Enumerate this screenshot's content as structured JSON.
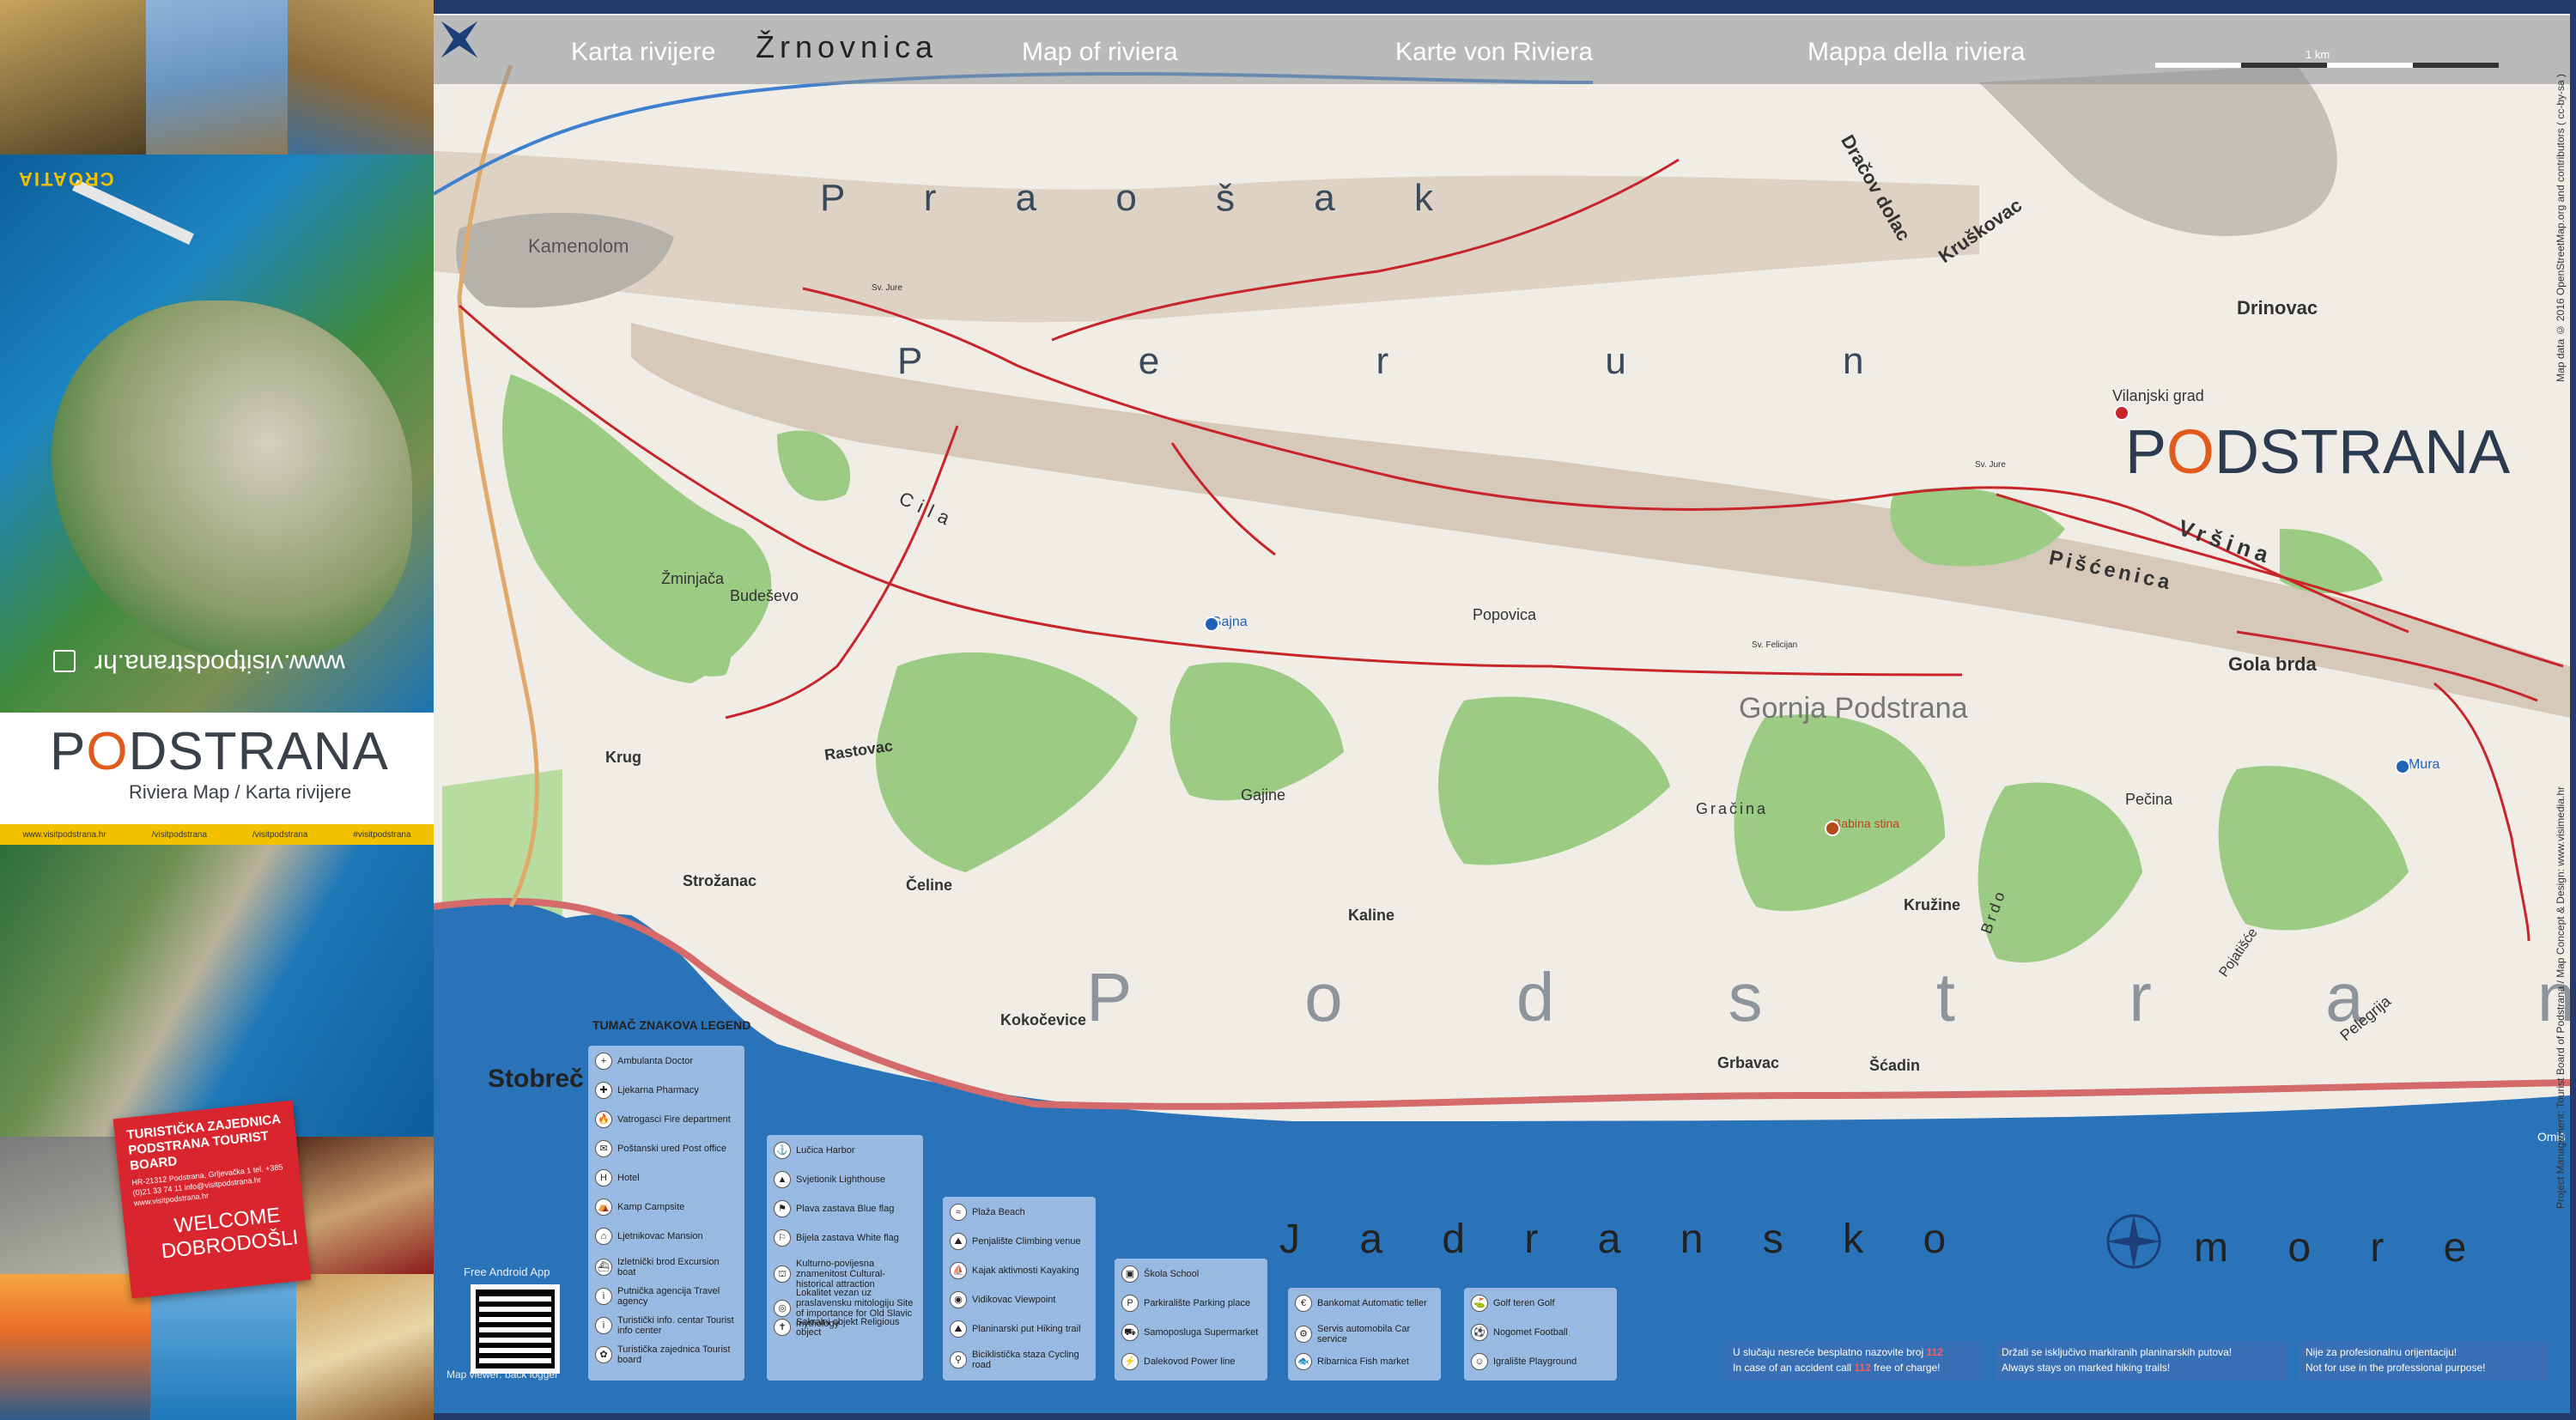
{
  "left_panel": {
    "croatia": "CROATIA",
    "website_rotated": "www.visitpodstrana.hr",
    "brand": {
      "pre": "P",
      "o": "O",
      "post": "DSTRANA"
    },
    "brand_sub": "Riviera Map / Karta rivijere",
    "social": [
      "www.visitpodstrana.hr",
      "/visitpodstrana",
      "/visitpodstrana",
      "#visitpodstrana"
    ],
    "tz": {
      "title": "TURISTIČKA ZAJEDNICA PODSTRANA TOURIST BOARD",
      "address": "HR-21312 Podstrana, Grljevačka 1 tel. +385 (0)21 33 74 11 info@visitpodstrana.hr www.visitpodstrana.hr",
      "welcome": "WELCOME DOBRODOŠLI"
    }
  },
  "map": {
    "titles": [
      "Karta rivijere",
      "Map of riviera",
      "Karte von Riviera",
      "Mappa della riviera"
    ],
    "scale": "1 km",
    "brand": {
      "pre": "P",
      "o": "O",
      "post": "DSTRANA"
    },
    "places": {
      "zrnovnica": "Žrnovnica",
      "kamenolom": "Kamenolom",
      "praosak": "P r a o š a k",
      "perun": "P e r u n",
      "dracov": "Dračov dolac",
      "kruskovac": "Kruškovac",
      "drinovac": "Drinovac",
      "vilanjski": "Vilanjski grad",
      "vrsina": "Vršina",
      "piscenica": "Pišćenica",
      "gola_brda": "Gola brda",
      "cila": "Cila",
      "zminjaca": "Žminjača",
      "budesevo": "Budeševo",
      "gajna": "Gajna",
      "popovica": "Popovica",
      "gornja": "Gornja Podstrana",
      "mura": "Mura",
      "krug": "Krug",
      "rastovac": "Rastovac",
      "gajine": "Gajine",
      "gracina": "Gračina",
      "babina": "Babina stina",
      "pecina": "Pečina",
      "strozanac": "Strožanac",
      "celine": "Čeline",
      "kaline": "Kaline",
      "kruzine": "Kružine",
      "brdo": "Brdo",
      "pojatisce": "Pojatišće",
      "podstrana_big": "P o d s t r a n a",
      "kokocevice": "Kokočevice",
      "grbavac": "Grbavac",
      "scadin": "Šćadin",
      "pelegrija": "Pelegrija",
      "stobrec": "Stobreč",
      "jadransko": "J a d r a n s k o",
      "more": "m o r e",
      "omis": "Omiš",
      "sv_jure": "Sv. Jure",
      "sv_jure2": "Sv. Jure",
      "sv_felicijan": "Sv. Felicijan"
    },
    "credit_top": "Map data © 2016 OpenStreetMap.org and contributors ( cc-by-sa )",
    "credit_bottom": "Project Management: Tourist Board of Podstrana / Map Concept & Design: www.visimedia.hr",
    "qr_top": "Free Android App",
    "qr_bottom": "Map viewer: back logger"
  },
  "legend": {
    "title": "TUMAČ ZNAKOVA LEGEND",
    "col1": [
      {
        "icon": "+",
        "label": "Ambulanta Doctor"
      },
      {
        "icon": "✚",
        "label": "Ljekarna Pharmacy"
      },
      {
        "icon": "🔥",
        "label": "Vatrogasci Fire department"
      },
      {
        "icon": "✉",
        "label": "Poštanski ured Post office"
      },
      {
        "icon": "H",
        "label": "Hotel"
      },
      {
        "icon": "⛺",
        "label": "Kamp Campsite"
      },
      {
        "icon": "⌂",
        "label": "Ljetnikovac Mansion"
      },
      {
        "icon": "⛴",
        "label": "Izletnički brod Excursion boat"
      },
      {
        "icon": "i",
        "label": "Putnička agencija Travel agency"
      },
      {
        "icon": "i",
        "label": "Turistički info. centar Tourist info center"
      },
      {
        "icon": "✿",
        "label": "Turistička zajednica Tourist board"
      }
    ],
    "col2": [
      {
        "icon": "⚓",
        "label": "Lučica Harbor"
      },
      {
        "icon": "▲",
        "label": "Svjetionik Lighthouse"
      },
      {
        "icon": "⚑",
        "label": "Plava zastava Blue flag"
      },
      {
        "icon": "⚐",
        "label": "Bijela zastava White flag"
      },
      {
        "icon": "⛫",
        "label": "Kulturno-povijesna znamenitost Cultural-historical attraction"
      },
      {
        "icon": "◎",
        "label": "Lokalitet vezan uz praslavensku mitologiju Site of importance for Old Slavic mythology"
      },
      {
        "icon": "✝",
        "label": "Sakralni objekt Religious object"
      }
    ],
    "col3": [
      {
        "icon": "≈",
        "label": "Plaža Beach"
      },
      {
        "icon": "⛰",
        "label": "Penjalište Climbing venue"
      },
      {
        "icon": "⛵",
        "label": "Kajak aktivnosti Kayaking"
      },
      {
        "icon": "◉",
        "label": "Vidikovac Viewpoint"
      },
      {
        "icon": "⛰",
        "label": "Planinarski put Hiking trail"
      },
      {
        "icon": "⚲",
        "label": "Biciklistička staza Cycling road"
      }
    ],
    "col4": [
      {
        "icon": "▣",
        "label": "Škola School"
      },
      {
        "icon": "P",
        "label": "Parkiralište Parking place"
      },
      {
        "icon": "⛟",
        "label": "Samoposluga Supermarket"
      },
      {
        "icon": "⚡",
        "label": "Dalekovod Power line"
      }
    ],
    "col5": [
      {
        "icon": "€",
        "label": "Bankomat Automatic teller"
      },
      {
        "icon": "⚙",
        "label": "Servis automobila Car service"
      },
      {
        "icon": "🐟",
        "label": "Ribarnica Fish market"
      }
    ],
    "col6": [
      {
        "icon": "⛳",
        "label": "Golf teren Golf"
      },
      {
        "icon": "⚽",
        "label": "Nogomet Football"
      },
      {
        "icon": "☺",
        "label": "Igralište Playground"
      }
    ]
  },
  "notices": {
    "n1_line1_pre": "U slučaju nesreće besplatno nazovite broj",
    "n1_line1_num": "112",
    "n1_line2_pre": "In case of an accident call",
    "n1_line2_num": "112",
    "n1_line2_post": "free of charge!",
    "n2_line1": "Držati se isključivo markiranih planinarskih putova!",
    "n2_line2": "Always stays on marked hiking trails!",
    "n3_line1": "Nije za profesionalnu orijentaciju!",
    "n3_line2": "Not for use in the professional purpose!"
  },
  "colors": {
    "trail": "#c8252a",
    "sea": "#2a73b8",
    "forest": "#9ccb84",
    "mountain": "#d8cfc2"
  }
}
